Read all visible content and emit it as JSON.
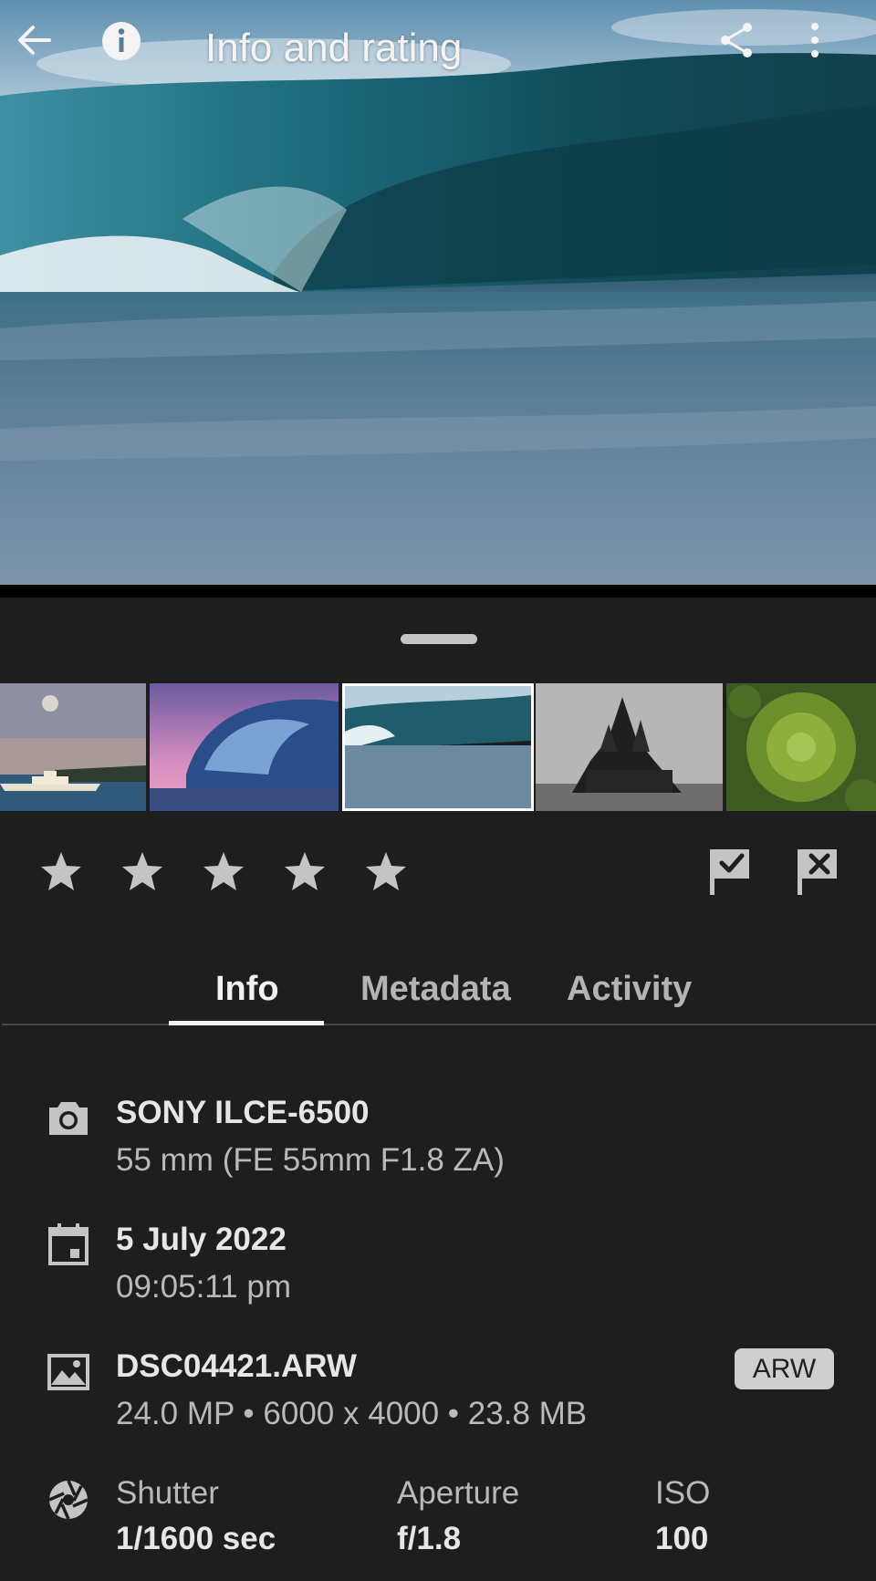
{
  "header": {
    "title": "Info and rating",
    "icons": [
      "back-arrow-icon",
      "info-icon",
      "share-icon",
      "more-vertical-icon"
    ]
  },
  "filmstrip": {
    "thumbnails": [
      "ferry-moon-thumbnail",
      "wave-pink-sky-thumbnail",
      "wave-teal-thumbnail",
      "stave-church-thumbnail",
      "pine-tree-thumbnail"
    ],
    "selected_index": 2
  },
  "rating": {
    "stars": 0,
    "max_stars": 5,
    "flags": [
      "pick-flag-icon",
      "reject-flag-icon"
    ]
  },
  "tabs": [
    {
      "label": "Info",
      "active": true
    },
    {
      "label": "Metadata",
      "active": false
    },
    {
      "label": "Activity",
      "active": false
    }
  ],
  "info": {
    "camera": {
      "title": "SONY ILCE-6500",
      "subtitle": "55 mm (FE 55mm F1.8 ZA)",
      "icon": "camera-icon"
    },
    "date": {
      "title": "5 July 2022",
      "subtitle": "09:05:11 pm",
      "icon": "calendar-icon"
    },
    "file": {
      "title": "DSC04421.ARW",
      "subtitle": "24.0 MP • 6000 x 4000 • 23.8 MB",
      "badge": "ARW",
      "icon": "image-icon"
    },
    "exposure": {
      "icon": "aperture-icon",
      "shutter_label": "Shutter",
      "shutter_value": "1/1600 sec",
      "aperture_label": "Aperture",
      "aperture_value": "f/1.8",
      "iso_label": "ISO",
      "iso_value": "100"
    }
  },
  "colors": {
    "background": "#1e1e1e",
    "text_primary": "#e6e6e6",
    "text_secondary": "#b9b9b9",
    "badge": "#cfcfcf"
  }
}
